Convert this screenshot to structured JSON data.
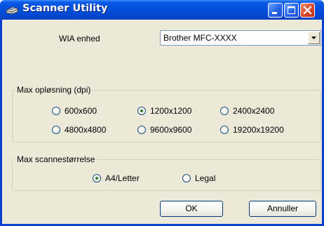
{
  "window": {
    "title": "Scanner Utility"
  },
  "title_buttons": [
    "minimize-icon",
    "maximize-icon",
    "close-icon"
  ],
  "device": {
    "label": "WIA enhed",
    "selected": "Brother MFC-XXXX"
  },
  "resolution": {
    "legend": "Max opløsning (dpi)",
    "options": [
      "600x600",
      "1200x1200",
      "2400x2400",
      "4800x4800",
      "9600x9600",
      "19200x19200"
    ],
    "selected": "1200x1200"
  },
  "scan_size": {
    "legend": "Max scannestørrelse",
    "options": [
      "A4/Letter",
      "Legal"
    ],
    "selected": "A4/Letter"
  },
  "buttons": {
    "ok": "OK",
    "cancel": "Annuller"
  },
  "colors": {
    "titlebar": "#0450dd",
    "close": "#d9462b",
    "face": "#ece9d8"
  }
}
